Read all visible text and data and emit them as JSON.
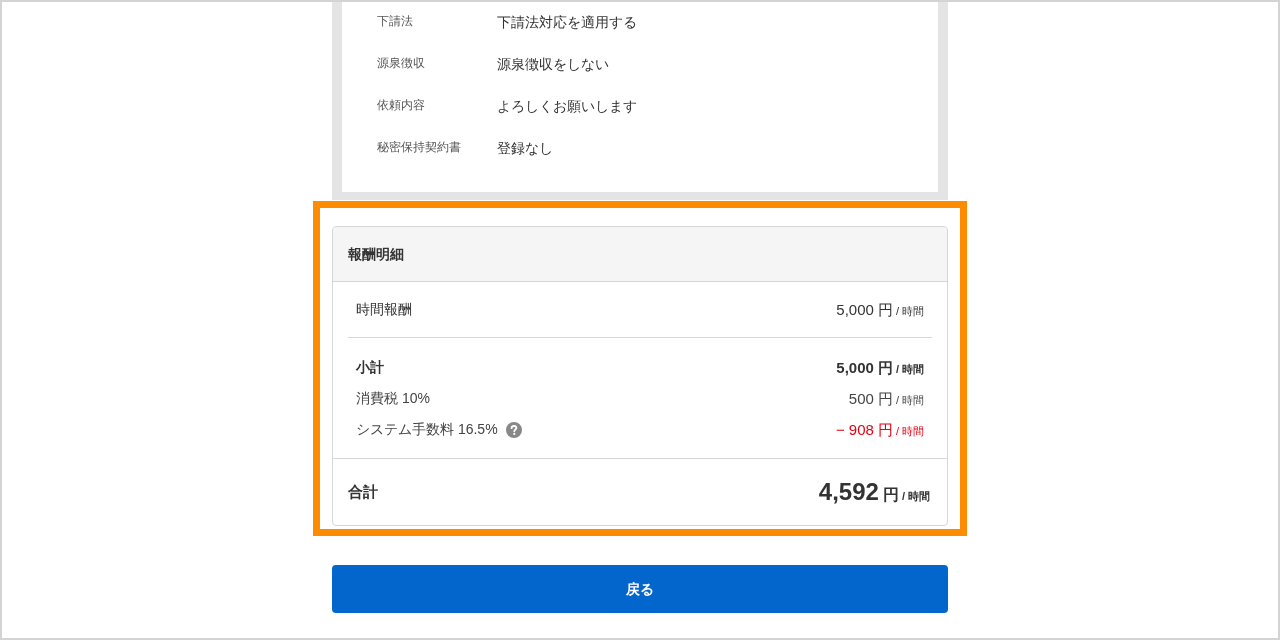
{
  "details": [
    {
      "label": "下請法",
      "value": "下請法対応を適用する"
    },
    {
      "label": "源泉徴収",
      "value": "源泉徴収をしない"
    },
    {
      "label": "依頼内容",
      "value": "よろしくお願いします"
    },
    {
      "label": "秘密保持契約書",
      "value": "登録なし"
    }
  ],
  "breakdown": {
    "highlighted": true,
    "title": "報酬明細",
    "items": [
      {
        "label": "時間報酬",
        "amount": "5,000",
        "currency": "円",
        "unit": "/ 時間"
      }
    ],
    "summary": [
      {
        "kind": "subtotal",
        "label": "小計",
        "amount": "5,000",
        "currency": "円",
        "unit": "/ 時間",
        "help": false
      },
      {
        "kind": "plain",
        "label": "消費税 10%",
        "amount": "500",
        "currency": "円",
        "unit": "/ 時間",
        "help": false
      },
      {
        "kind": "deduction",
        "label": "システム手数料 16.5%",
        "amount": "− 908",
        "currency": "円",
        "unit": "/ 時間",
        "help": true
      }
    ],
    "total": {
      "label": "合計",
      "amount": "4,592",
      "currency": "円",
      "unit": "/ 時間"
    }
  },
  "back_button": {
    "label": "戻る"
  }
}
